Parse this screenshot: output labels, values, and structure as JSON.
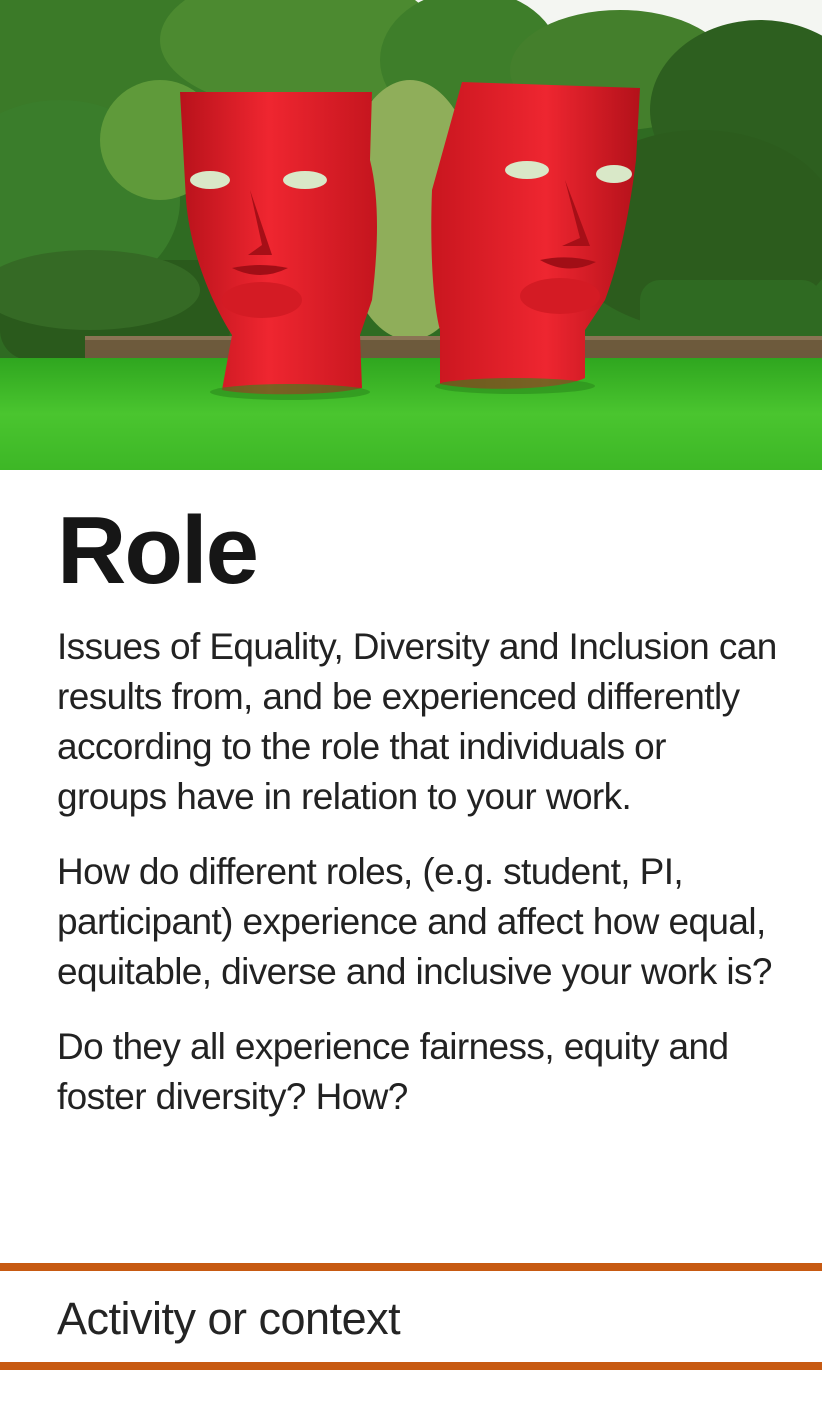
{
  "hero": {
    "image_alt": "red mask head sculptures on lawn",
    "colors": {
      "sculpture": "#e41c24",
      "grass": "#3fc12a",
      "trees": "#2f6b22",
      "sky": "#f4f6f2"
    }
  },
  "card": {
    "title": "Role",
    "paragraphs": [
      "Issues of Equality, Diversity and Inclusion can results from, and be experienced differently according to the role that individuals or groups have in relation to your work.",
      "How do different roles, (e.g.  student, PI, participant) experience and affect how equal, equitable, diverse and inclusive your work is?",
      "Do they all experience fairness, equity and foster diversity? How?"
    ],
    "footer_label": "Activity or context",
    "accent_color": "#c75a12"
  }
}
